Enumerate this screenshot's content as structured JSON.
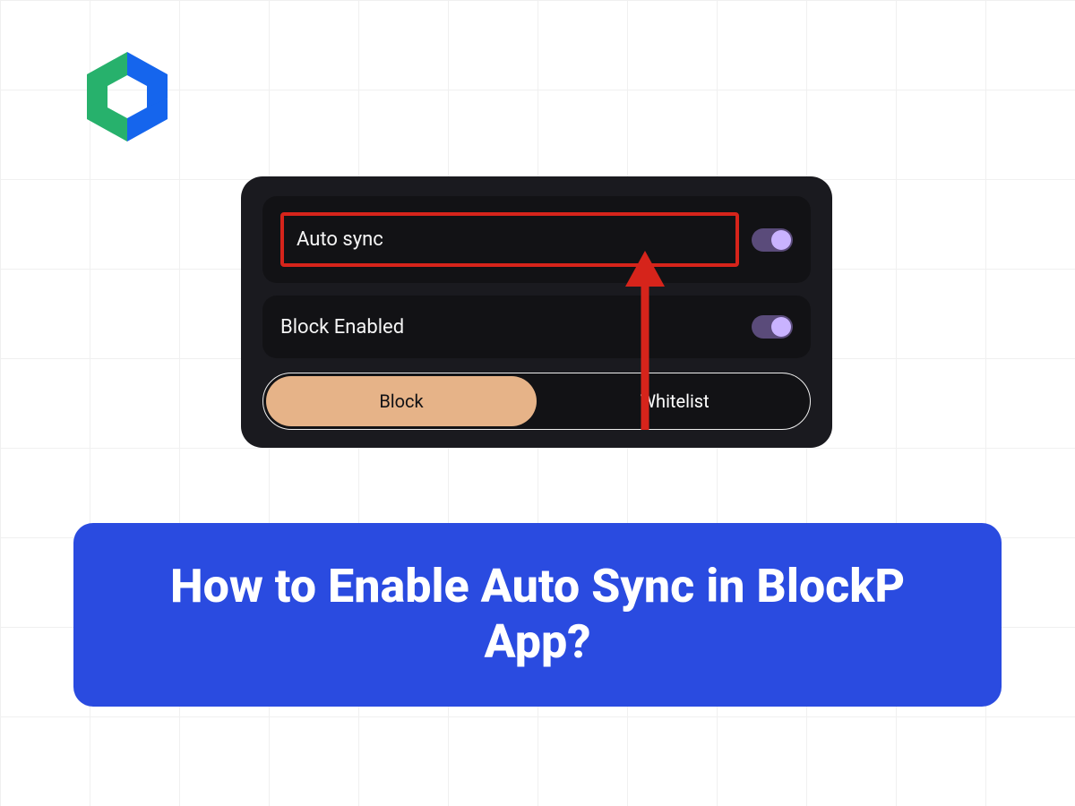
{
  "settings": {
    "auto_sync": {
      "label": "Auto sync",
      "on": true
    },
    "block_enabled": {
      "label": "Block Enabled",
      "on": true
    },
    "segmented": {
      "block": "Block",
      "whitelist": "Whitelist",
      "selected": "block"
    }
  },
  "title": {
    "text": "How to Enable Auto Sync in BlockP App?"
  },
  "colors": {
    "accent_blue": "#2a4be0",
    "logo_blue": "#1565ed",
    "logo_green": "#27b16c",
    "highlight_red": "#d6241b",
    "card_bg": "#1a1a1f",
    "row_bg": "#121215",
    "toggle_track": "#5a4b7a",
    "toggle_knob": "#c9b3ff",
    "segment_active": "#e6b388"
  }
}
